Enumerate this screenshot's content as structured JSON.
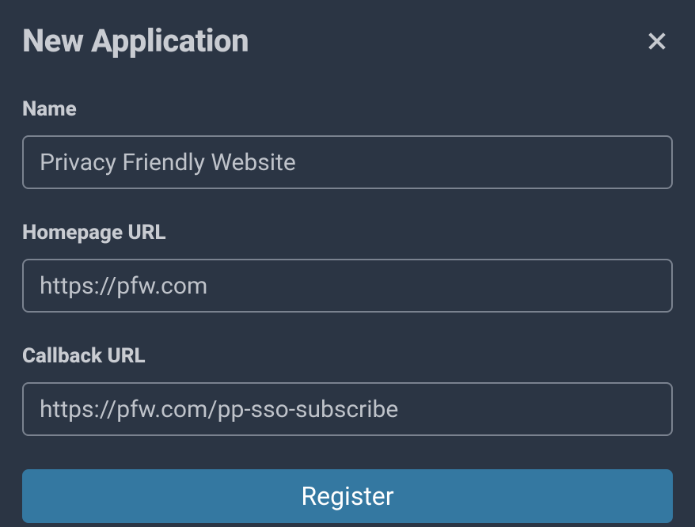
{
  "dialog": {
    "title": "New Application"
  },
  "form": {
    "name": {
      "label": "Name",
      "value": "Privacy Friendly Website"
    },
    "homepage": {
      "label": "Homepage URL",
      "value": "https://pfw.com"
    },
    "callback": {
      "label": "Callback URL",
      "value": "https://pfw.com/pp-sso-subscribe"
    },
    "submit_label": "Register"
  }
}
